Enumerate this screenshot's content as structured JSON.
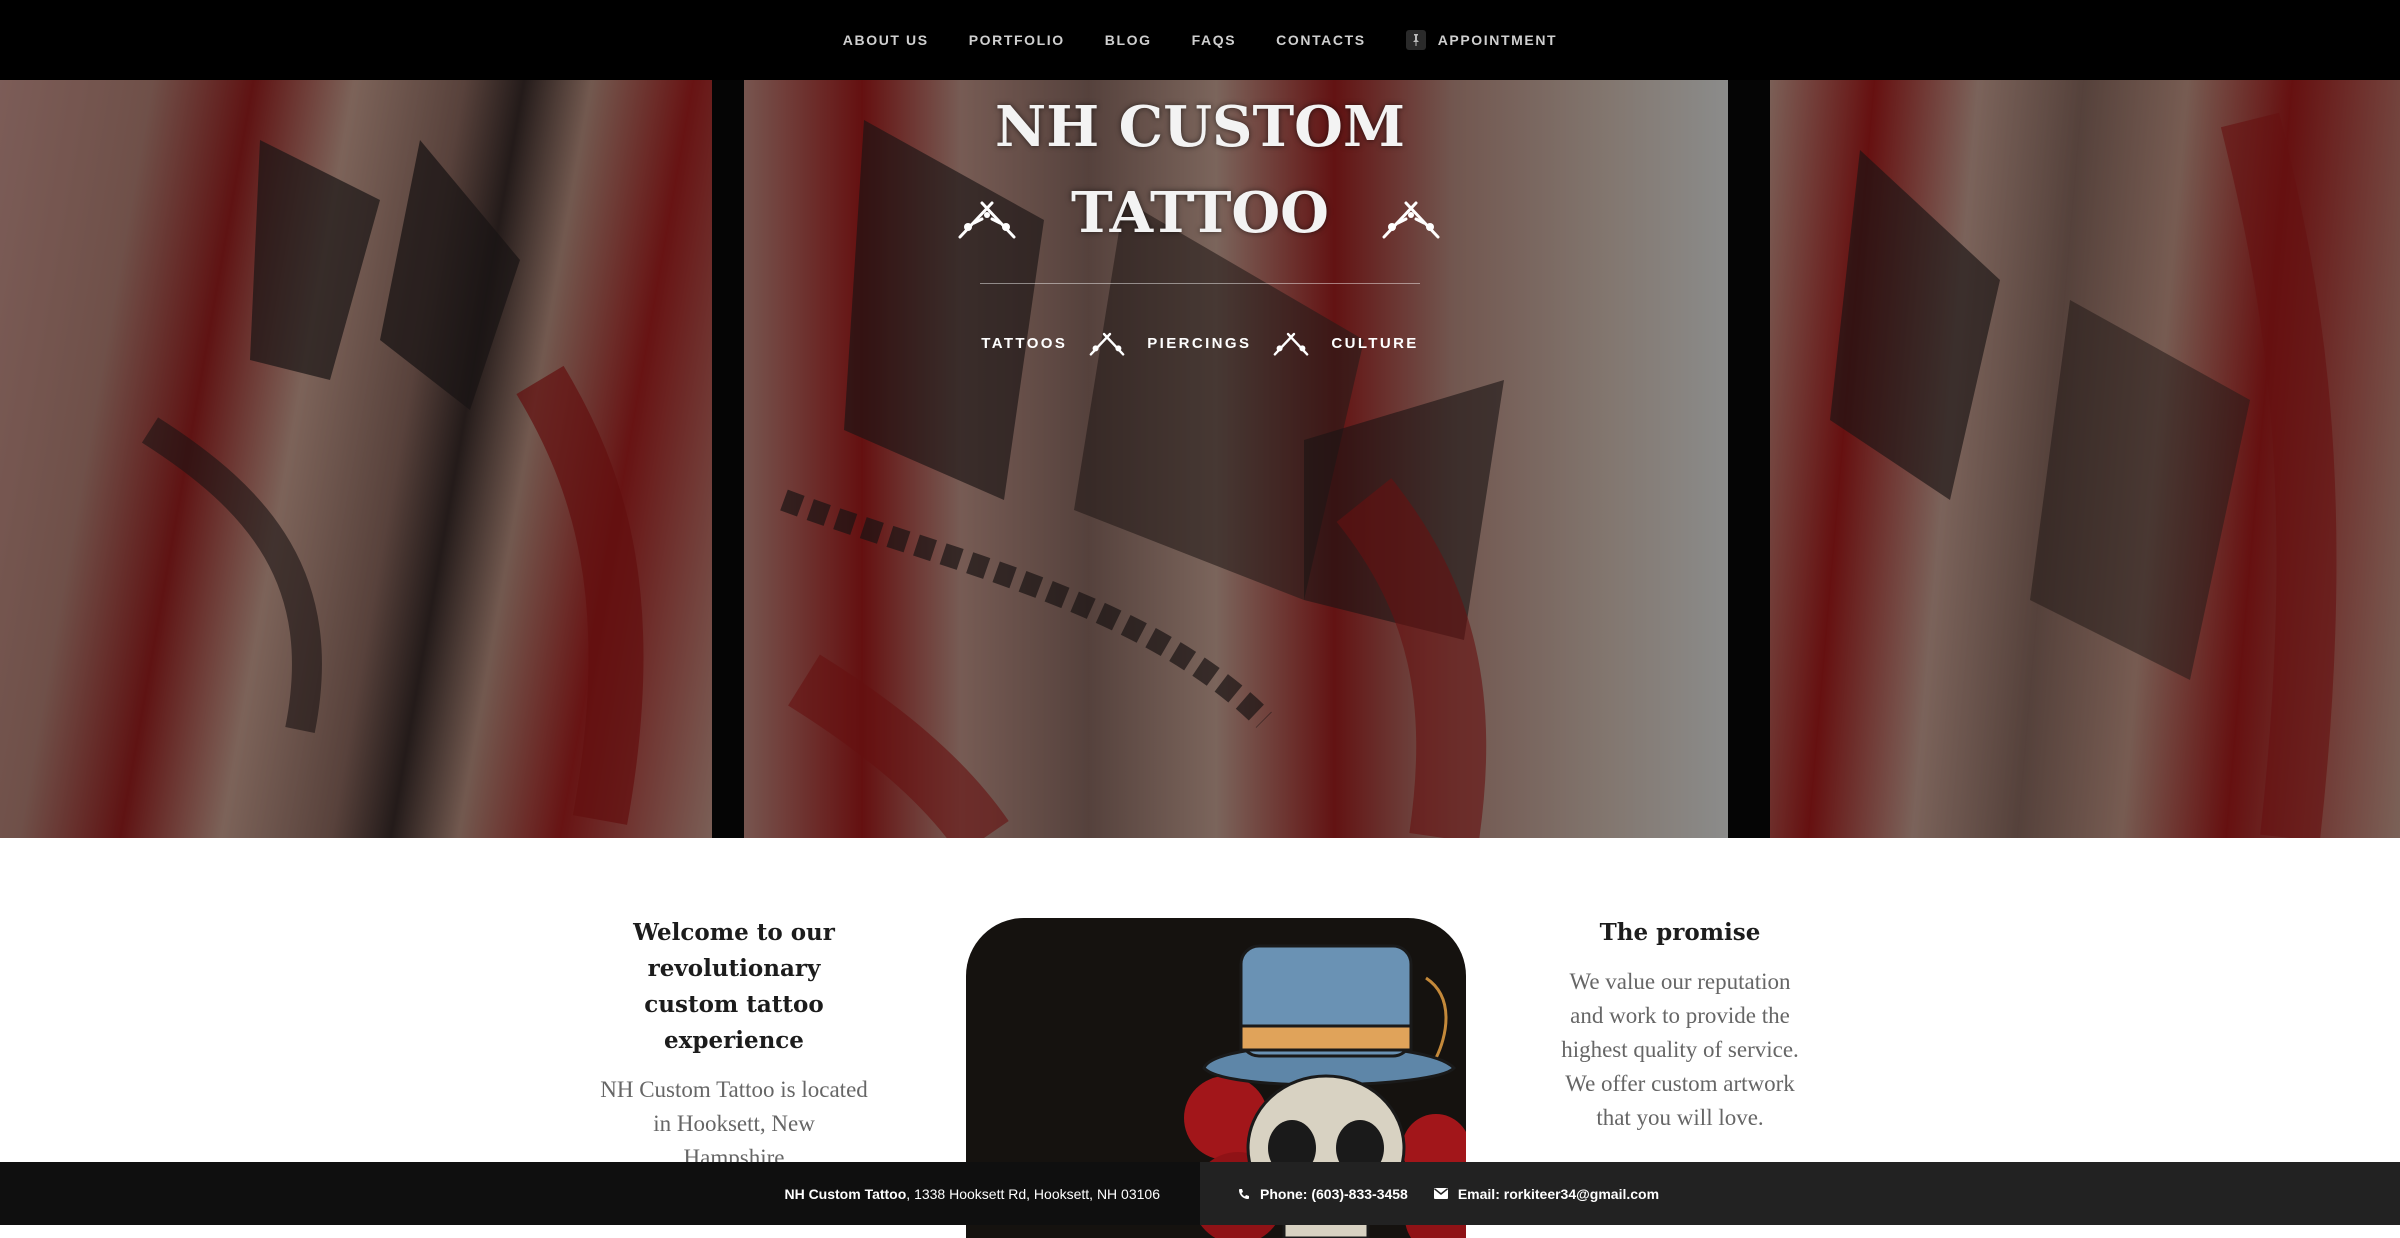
{
  "nav": {
    "items": [
      {
        "label": "ABOUT US"
      },
      {
        "label": "PORTFOLIO"
      },
      {
        "label": "BLOG"
      },
      {
        "label": "FAQS"
      },
      {
        "label": "CONTACTS"
      }
    ],
    "appointment_label": "APPOINTMENT"
  },
  "hero": {
    "title_line1": "NH CUSTOM",
    "title_line2": "TATTOO",
    "subnav": [
      "TATTOOS",
      "PIERCINGS",
      "CULTURE"
    ]
  },
  "welcome": {
    "heading": "Welcome to our revolutionary custom tattoo experience",
    "text": "NH Custom Tattoo is located in Hooksett, New Hampshire"
  },
  "promise": {
    "heading": "The promise",
    "text": "We value our reputation and work to provide the highest quality of service. We offer custom artwork that you will love."
  },
  "footer": {
    "business_name": "NH Custom Tattoo",
    "address": ", 1338 Hooksett Rd, Hooksett, NH 03106",
    "phone": "Phone: (603)-833-3458",
    "email": "Email: rorkiteer34@gmail.com"
  },
  "colors": {
    "nav_bg": "#000000",
    "footer_bg": "#222222",
    "accent_red": "#b01515"
  }
}
